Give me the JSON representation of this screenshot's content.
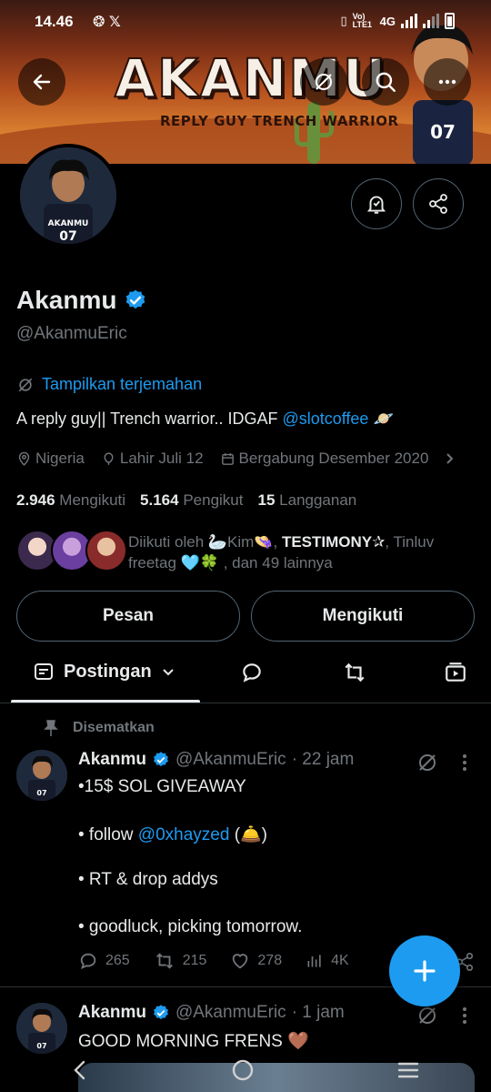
{
  "status_bar": {
    "time": "14.46",
    "network": "4G",
    "volte": "Vo) LTE1"
  },
  "banner": {
    "title": "AKANMU",
    "subtitle": "REPLY GUY TRENCH WARRIOR"
  },
  "profile": {
    "name": "Akanmu",
    "handle": "@AkanmuEric",
    "translate_label": "Tampilkan terjemahan",
    "bio_text": "A reply guy|| Trench warrior.. IDGAF ",
    "bio_mention": "@slotcoffee",
    "bio_emoji": "🪐",
    "location": "Nigeria",
    "birthday": "Lahir Juli 12",
    "joined": "Bergabung Desember 2020",
    "following_count": "2.946",
    "following_label": "Mengikuti",
    "followers_count": "5.164",
    "followers_label": "Pengikut",
    "subscriptions_count": "15",
    "subscriptions_label": "Langganan",
    "followed_by_prefix": "Diikuti oleh ",
    "followed_by_1": "🦢Kim👒",
    "followed_by_sep1": ", ",
    "followed_by_2": "TESTIMONY✰",
    "followed_by_rest": ", Tinluv freetag 🩵🍀 , dan 49 lainnya"
  },
  "buttons": {
    "message": "Pesan",
    "following": "Mengikuti"
  },
  "tabs": {
    "active": "Postingan"
  },
  "pinned_label": "Disematkan",
  "tweets": [
    {
      "name": "Akanmu",
      "handle": "@AkanmuEric",
      "time": "· 22 jam",
      "line1": "•15$ SOL GIVEAWAY",
      "line2_prefix": "• follow ",
      "line2_mention": "@0xhayzed",
      "line2_suffix": " (🛎️)",
      "line3": "• RT & drop addys",
      "line4": "• goodluck, picking tomorrow.",
      "replies": "265",
      "retweets": "215",
      "likes": "278",
      "views": "4K"
    },
    {
      "name": "Akanmu",
      "handle": "@AkanmuEric",
      "time": "· 1 jam",
      "text": "GOOD MORNING FRENS 🤎"
    }
  ],
  "colors": {
    "accent": "#1d9bf0",
    "background": "#000000",
    "muted": "#71767b",
    "text": "#e7e9ea"
  }
}
